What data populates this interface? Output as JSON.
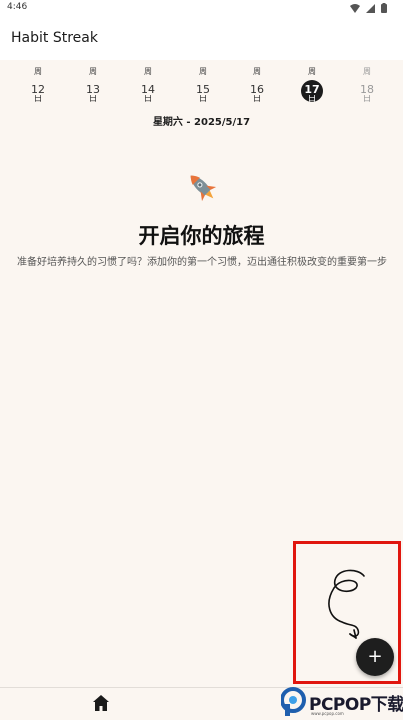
{
  "status_bar": {
    "time": "4:46"
  },
  "app_bar": {
    "title": "Habit Streak"
  },
  "week": {
    "days": [
      {
        "weekday": "周",
        "num": "12",
        "char": "日"
      },
      {
        "weekday": "周",
        "num": "13",
        "char": "日"
      },
      {
        "weekday": "周",
        "num": "14",
        "char": "日"
      },
      {
        "weekday": "周",
        "num": "15",
        "char": "日"
      },
      {
        "weekday": "周",
        "num": "16",
        "char": "日"
      },
      {
        "weekday": "周",
        "num": "17",
        "char": "日"
      },
      {
        "weekday": "周",
        "num": "18",
        "char": "日"
      }
    ],
    "selected_index": 5,
    "selected_date_label": "星期六 - 2025/5/17"
  },
  "empty_state": {
    "icon": "rocket-icon",
    "title": "开启你的旅程",
    "description": "准备好培养持久的习惯了吗？添加你的第一个习惯，迈出通往积极改变的重要第一步"
  },
  "fab": {
    "label": "+",
    "icon": "plus-icon"
  },
  "bottom_nav": {
    "items": [
      {
        "icon": "home-icon"
      }
    ]
  },
  "annotation": {
    "color": "#e0160f"
  },
  "watermark": {
    "brand": "PCPOP下载",
    "sub": "www.pcpop.com"
  },
  "colors": {
    "background": "#fbf6f1",
    "appbar": "#ffffff",
    "selected_day": "#1c1c1c",
    "fab": "#1e1e1e",
    "rocket_orange": "#e8743b"
  }
}
